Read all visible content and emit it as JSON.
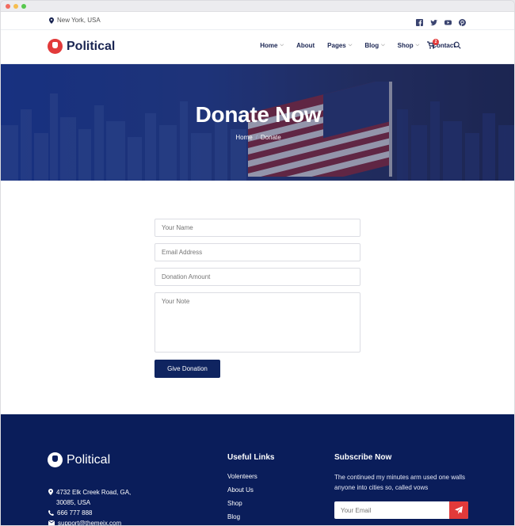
{
  "topbar": {
    "location": "New York, USA",
    "social": [
      "facebook-icon",
      "twitter-icon",
      "youtube-icon",
      "pinterest-icon"
    ]
  },
  "brand": {
    "name": "Political"
  },
  "nav": {
    "items": [
      {
        "label": "Home",
        "dropdown": true
      },
      {
        "label": "About",
        "dropdown": false
      },
      {
        "label": "Pages",
        "dropdown": true
      },
      {
        "label": "Blog",
        "dropdown": true
      },
      {
        "label": "Shop",
        "dropdown": true
      },
      {
        "label": "Contact",
        "dropdown": false
      }
    ],
    "cart_count": "2"
  },
  "hero": {
    "title": "Donate Now",
    "breadcrumb": {
      "home": "Home",
      "current": "Donate"
    }
  },
  "form": {
    "name_placeholder": "Your Name",
    "email_placeholder": "Email Address",
    "amount_placeholder": "Donation Amount",
    "note_placeholder": "Your Note",
    "submit_label": "Give Donation"
  },
  "footer": {
    "brand": "Political",
    "address_line1": "4732 Elk Creek Road, GA,",
    "address_line2": "30085, USA",
    "phone": "666 777 888",
    "email": "support@themeix.com",
    "useful_links_title": "Useful Links",
    "useful_links": [
      "Volenteers",
      "About Us",
      "Shop",
      "Blog"
    ],
    "subscribe_title": "Subscribe Now",
    "subscribe_text": "The continued my minutes arm used one walls anyone into cities so, called vows",
    "subscribe_placeholder": "Your Email"
  },
  "colors": {
    "brand_red": "#e23a3a",
    "navy": "#0a1d5a",
    "button": "#0f2460"
  }
}
